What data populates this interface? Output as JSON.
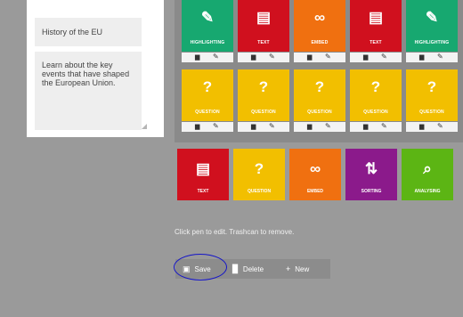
{
  "details": {
    "title_value": "History of the EU",
    "description_value": "Learn about the key events that have shaped the European Union."
  },
  "grid": {
    "row1": [
      {
        "label": "HIGHLIGHTING",
        "color": "#17a870",
        "icon": "highlighter-icon",
        "glyph": "✎"
      },
      {
        "label": "TEXT",
        "color": "#d0101e",
        "icon": "document-icon",
        "glyph": "▤"
      },
      {
        "label": "EMBED",
        "color": "#f07010",
        "icon": "link-icon",
        "glyph": "∞"
      },
      {
        "label": "TEXT",
        "color": "#d0101e",
        "icon": "document-icon",
        "glyph": "▤"
      },
      {
        "label": "HIGHLIGHTING",
        "color": "#17a870",
        "icon": "highlighter-icon",
        "glyph": "✎"
      }
    ],
    "row2": [
      {
        "label": "QUESTION",
        "color": "#f2bf00",
        "icon": "question-icon",
        "glyph": "?"
      },
      {
        "label": "QUESTION",
        "color": "#f2bf00",
        "icon": "question-icon",
        "glyph": "?"
      },
      {
        "label": "QUESTION",
        "color": "#f2bf00",
        "icon": "question-icon",
        "glyph": "?"
      },
      {
        "label": "QUESTION",
        "color": "#f2bf00",
        "icon": "question-icon",
        "glyph": "?"
      },
      {
        "label": "QUESTION",
        "color": "#f2bf00",
        "icon": "question-icon",
        "glyph": "?"
      }
    ]
  },
  "palette": [
    {
      "label": "TEXT",
      "color": "#d0101e",
      "icon": "document-icon",
      "glyph": "▤"
    },
    {
      "label": "QUESTION",
      "color": "#f2bf00",
      "icon": "question-icon",
      "glyph": "?"
    },
    {
      "label": "EMBED",
      "color": "#f07010",
      "icon": "link-icon",
      "glyph": "∞"
    },
    {
      "label": "SORTING",
      "color": "#8b1a8b",
      "icon": "sorting-icon",
      "glyph": "⇅"
    },
    {
      "label": "ANALYSING",
      "color": "#5cb514",
      "icon": "magnifier-icon",
      "glyph": "⌕"
    }
  ],
  "hint": "Click pen to edit. Trashcan to remove.",
  "toolbar": {
    "save_label": "Save",
    "delete_label": "Delete",
    "new_label": "New"
  }
}
